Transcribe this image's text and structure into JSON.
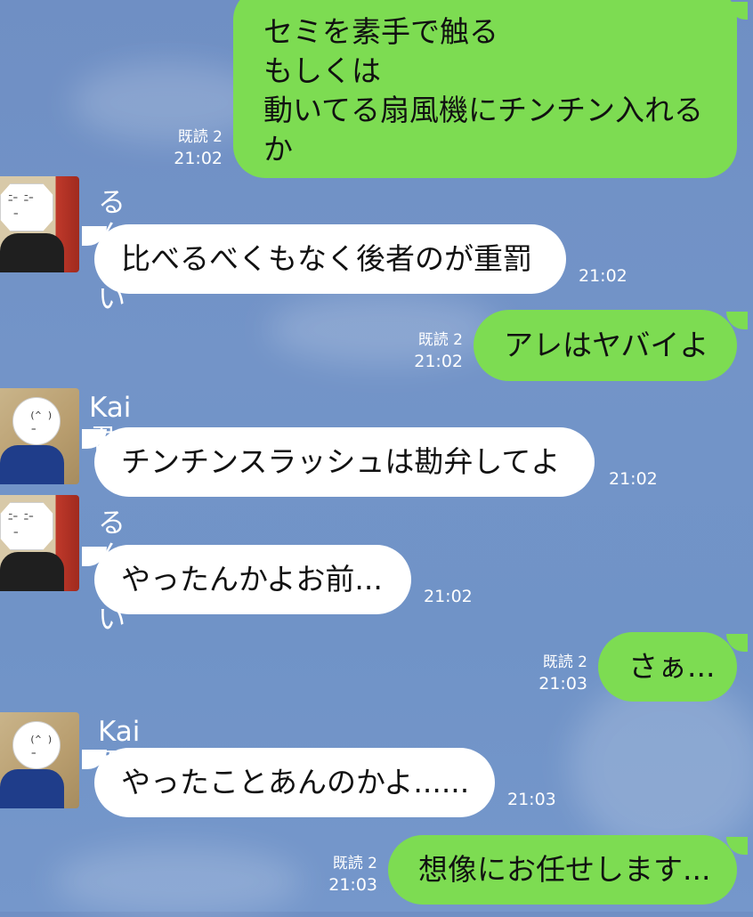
{
  "chat": {
    "messages": [
      {
        "side": "out",
        "lines": [
          "セミを素手で触る",
          "もしくは",
          "動いてる扇風機にチンチン入れる",
          "か"
        ],
        "read": "既読 2",
        "time": "21:02"
      },
      {
        "side": "in",
        "sender": "るんたい",
        "text": "比べるべくもなく後者のが重罰",
        "time": "21:02"
      },
      {
        "side": "out",
        "text": "アレはヤバイよ",
        "read": "既読 2",
        "time": "21:02"
      },
      {
        "side": "in",
        "sender": "Kai君",
        "text": "チンチンスラッシュは勘弁してよ",
        "time": "21:02"
      },
      {
        "side": "in",
        "sender": "るんたい",
        "text": "やったんかよお前...",
        "time": "21:02"
      },
      {
        "side": "out",
        "text": "さぁ...",
        "read": "既読 2",
        "time": "21:03"
      },
      {
        "side": "in",
        "sender": "Kai君",
        "text": "やったことあんのかよ......",
        "time": "21:03"
      },
      {
        "side": "out",
        "text": "想像にお任せします...",
        "read": "既読 2",
        "time": "21:03"
      }
    ]
  },
  "colors": {
    "background": "#7193c7",
    "outgoing_bubble": "#7ddc52",
    "incoming_bubble": "#ffffff"
  },
  "avatars": {
    "runtai": "user-avatar-photo",
    "kai": "user-avatar-photo"
  }
}
